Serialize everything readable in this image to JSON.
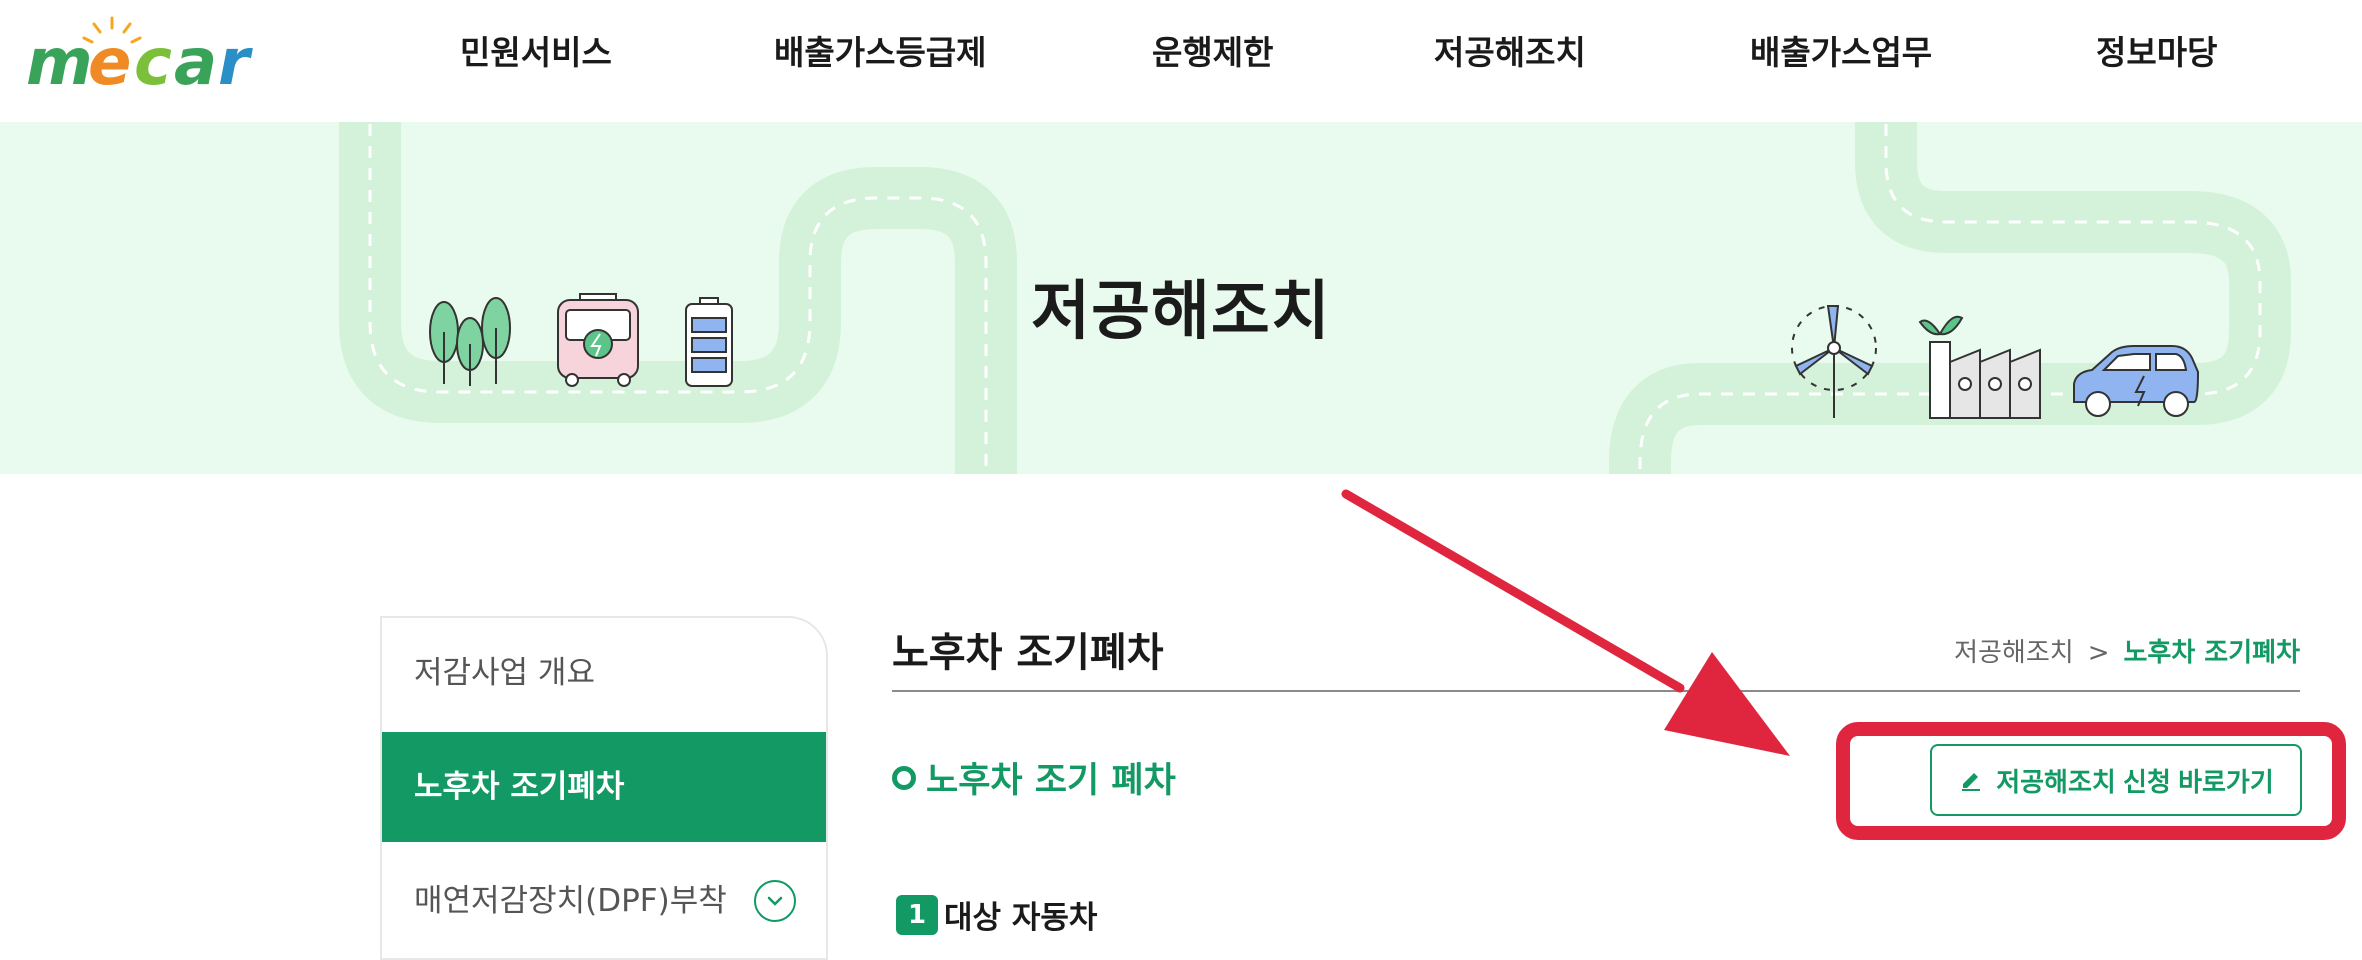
{
  "header": {
    "logo_text": "mecar",
    "nav": [
      "민원서비스",
      "배출가스등급제",
      "운행제한",
      "저공해조치",
      "배출가스업무",
      "정보마당"
    ]
  },
  "banner": {
    "title": "저공해조치"
  },
  "sidebar": {
    "items": [
      {
        "label": "저감사업 개요"
      },
      {
        "label": "노후차 조기폐차",
        "active": true
      },
      {
        "label": "매연저감장치(DPF)부착"
      }
    ]
  },
  "main": {
    "page_title": "노후차 조기폐차",
    "breadcrumb": {
      "parent": "저공해조치",
      "separator": ">",
      "current": "노후차 조기폐차"
    },
    "section_heading": "노후차 조기 폐차",
    "apply_button": "저공해조치 신청 바로가기",
    "sub_number": "1",
    "sub_heading": "대상 자동차"
  },
  "colors": {
    "accent": "#129964",
    "banner_bg": "#e8fbee",
    "highlight": "#e0263f"
  },
  "icons": [
    "trees-icon",
    "bus-icon",
    "battery-icon",
    "wind-turbine-icon",
    "factory-icon",
    "electric-car-icon",
    "pencil-icon",
    "chevron-down-icon"
  ]
}
